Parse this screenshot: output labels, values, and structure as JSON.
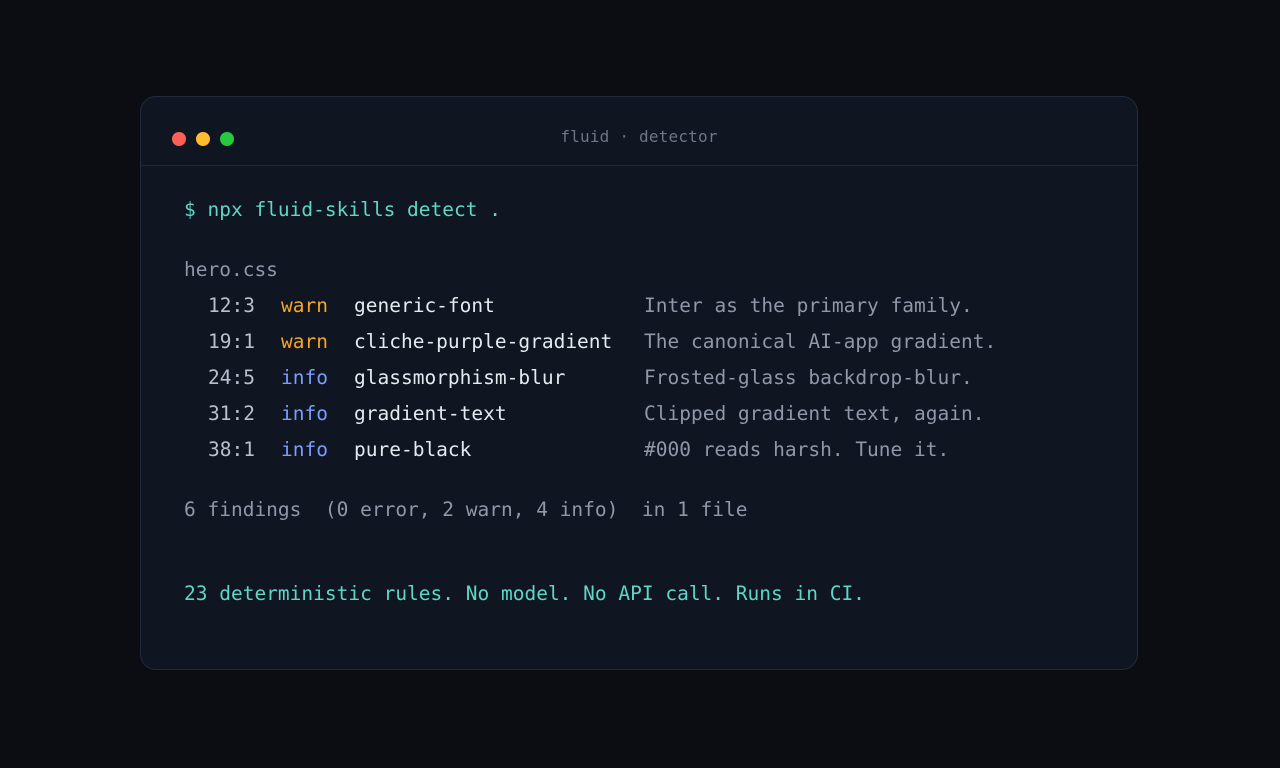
{
  "window": {
    "title": "fluid · detector",
    "controls": [
      "close",
      "minimize",
      "maximize"
    ]
  },
  "terminal": {
    "command": "$ npx fluid-skills detect .",
    "file": "hero.css",
    "findings": [
      {
        "loc": "12:3",
        "level": "warn",
        "rule": "generic-font",
        "message": "Inter as the primary family."
      },
      {
        "loc": "19:1",
        "level": "warn",
        "rule": "cliche-purple-gradient",
        "message": "The canonical AI-app gradient."
      },
      {
        "loc": "24:5",
        "level": "info",
        "rule": "glassmorphism-blur",
        "message": "Frosted-glass backdrop-blur."
      },
      {
        "loc": "31:2",
        "level": "info",
        "rule": "gradient-text",
        "message": "Clipped gradient text, again."
      },
      {
        "loc": "38:1",
        "level": "info",
        "rule": "pure-black",
        "message": "#000 reads harsh. Tune it."
      }
    ],
    "summary": "6 findings  (0 error, 2 warn, 4 info)  in 1 file",
    "tagline": "23 deterministic rules. No model. No API call. Runs in CI."
  },
  "colors": {
    "background": "#0b0d13",
    "window": "#0f1521",
    "accent": "#5fd6c6",
    "warn": "#f5a623",
    "info": "#7c9cff"
  }
}
